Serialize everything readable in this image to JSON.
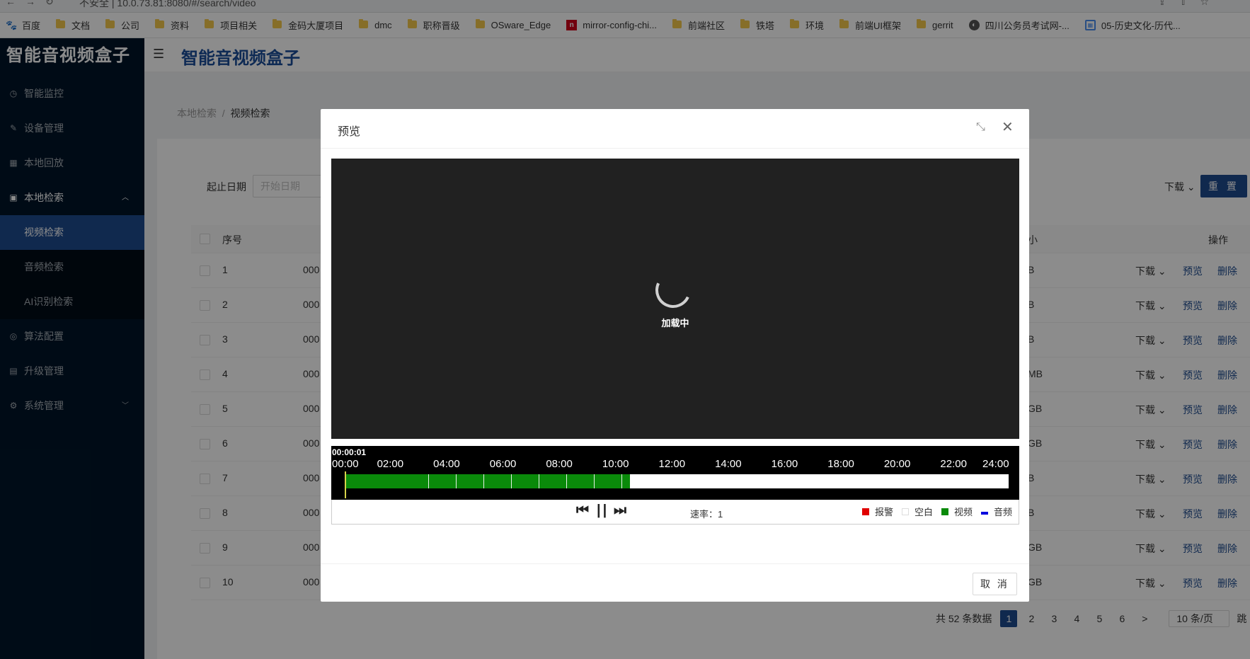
{
  "browser": {
    "url": "10.0.73.81:8080/#/search/video",
    "security_label": "不安全"
  },
  "bookmarks": [
    {
      "label": "百度",
      "icon": "baidu-paw-icon"
    },
    {
      "label": "文档",
      "icon": "folder-icon"
    },
    {
      "label": "公司",
      "icon": "folder-icon"
    },
    {
      "label": "资料",
      "icon": "folder-icon"
    },
    {
      "label": "项目相关",
      "icon": "folder-icon"
    },
    {
      "label": "金码大厦项目",
      "icon": "folder-icon"
    },
    {
      "label": "dmc",
      "icon": "folder-icon"
    },
    {
      "label": "职称晋级",
      "icon": "folder-icon"
    },
    {
      "label": "OSware_Edge",
      "icon": "folder-icon"
    },
    {
      "label": "mirror-config-chi...",
      "icon": "red-site-icon"
    },
    {
      "label": "前端社区",
      "icon": "folder-icon"
    },
    {
      "label": "铁塔",
      "icon": "folder-icon"
    },
    {
      "label": "环境",
      "icon": "folder-icon"
    },
    {
      "label": "前端UI框架",
      "icon": "folder-icon"
    },
    {
      "label": "gerrit",
      "icon": "folder-icon"
    },
    {
      "label": "四川公务员考试网-...",
      "icon": "globe-icon"
    },
    {
      "label": "05-历史文化-历代...",
      "icon": "calendar-icon"
    }
  ],
  "app": {
    "brand": "智能音视频盒子",
    "header_title": "智能音视频盒子"
  },
  "sidebar": {
    "items": [
      {
        "label": "智能监控",
        "icon": "monitor-icon"
      },
      {
        "label": "设备管理",
        "icon": "edit-icon"
      },
      {
        "label": "本地回放",
        "icon": "grid-icon"
      },
      {
        "label": "本地检索",
        "icon": "calendar-icon",
        "expanded": true
      },
      {
        "label": "视频检索",
        "active": true
      },
      {
        "label": "音频检索"
      },
      {
        "label": "AI识别检索"
      },
      {
        "label": "算法配置",
        "icon": "check-circle-icon"
      },
      {
        "label": "升级管理",
        "icon": "file-icon"
      },
      {
        "label": "系统管理",
        "icon": "gear-icon"
      }
    ]
  },
  "breadcrumb": {
    "parent": "本地检索",
    "separator": "/",
    "current": "视频检索"
  },
  "filters": {
    "date_label": "起止日期",
    "start_placeholder": "开始日期",
    "download_label": "下载",
    "reset_label": "重 置"
  },
  "table": {
    "headers": {
      "no": "序号",
      "size": "小",
      "op": "操作"
    },
    "rows": [
      {
        "no": "1",
        "name": "000",
        "size": "B"
      },
      {
        "no": "2",
        "name": "000",
        "size": "B"
      },
      {
        "no": "3",
        "name": "000",
        "size": "B"
      },
      {
        "no": "4",
        "name": "000",
        "size": "MB"
      },
      {
        "no": "5",
        "name": "000",
        "size": "GB"
      },
      {
        "no": "6",
        "name": "000",
        "size": "GB"
      },
      {
        "no": "7",
        "name": "000",
        "size": "B"
      },
      {
        "no": "8",
        "name": "000",
        "size": "B"
      },
      {
        "no": "9",
        "name": "000",
        "size": "GB"
      },
      {
        "no": "10",
        "name": "000",
        "size": "GB"
      }
    ],
    "ops": {
      "download": "下载",
      "preview": "预览",
      "delete": "删除"
    }
  },
  "pagination": {
    "total": "共 52 条数据",
    "pages": [
      "1",
      "2",
      "3",
      "4",
      "5",
      "6"
    ],
    "current": "1",
    "next": ">",
    "page_size": "10 条/页",
    "jump": "跳"
  },
  "dialog": {
    "title": "预览",
    "loading": "加载中",
    "current_time": "00:00:01",
    "ticks": [
      "00:00",
      "02:00",
      "04:00",
      "06:00",
      "08:00",
      "10:00",
      "12:00",
      "14:00",
      "16:00",
      "18:00",
      "20:00",
      "22:00",
      "24:00"
    ],
    "recorded_until_hours": 10.3,
    "rate_label": "速率：",
    "rate_value": "1",
    "legend": [
      {
        "label": "报警",
        "color": "#e00000"
      },
      {
        "label": "空白",
        "color": "#ffffff"
      },
      {
        "label": "视频",
        "color": "#0a8a0a"
      },
      {
        "label": "音频",
        "color": "#0000dd"
      }
    ],
    "cancel_label": "取 消"
  }
}
